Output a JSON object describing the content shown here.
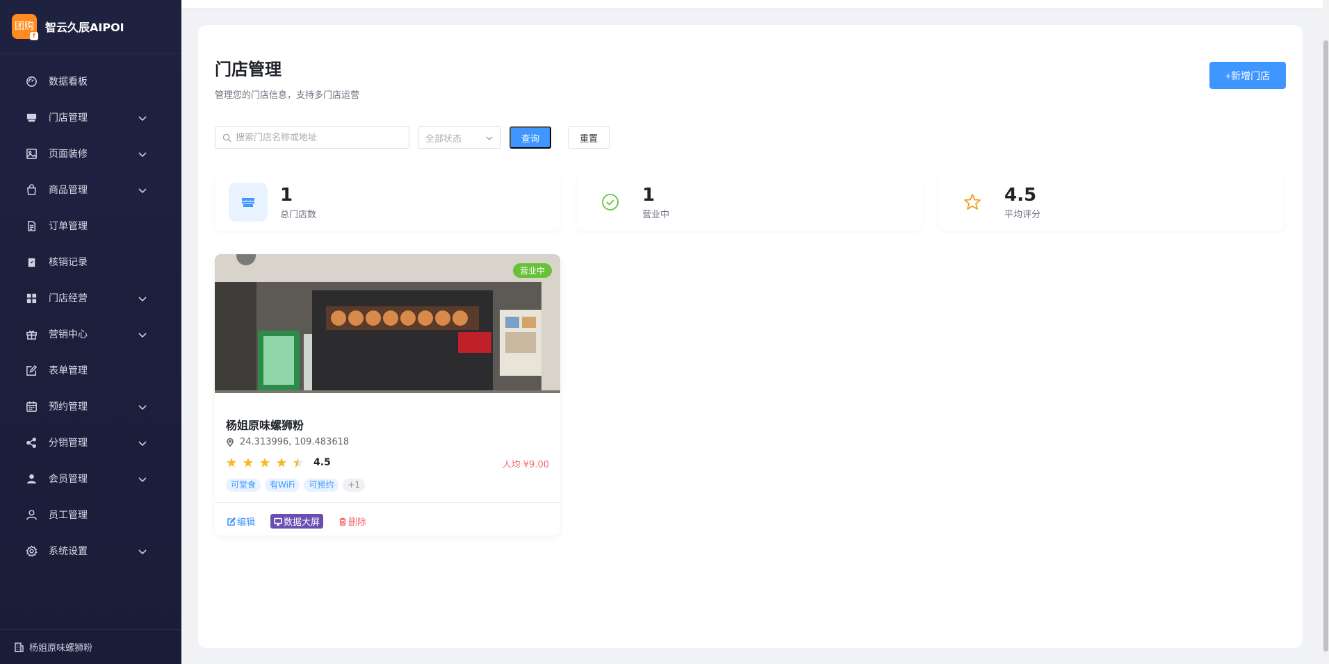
{
  "brand": {
    "logo_text": "团购",
    "logo_sub": "f",
    "name": "智云久辰AIPOI"
  },
  "sidebar": {
    "items": [
      {
        "label": "数据看板",
        "icon": "dashboard-icon",
        "expandable": false
      },
      {
        "label": "门店管理",
        "icon": "store-icon",
        "expandable": true
      },
      {
        "label": "页面装修",
        "icon": "image-icon",
        "expandable": true
      },
      {
        "label": "商品管理",
        "icon": "shopping-bag-icon",
        "expandable": true
      },
      {
        "label": "订单管理",
        "icon": "document-icon",
        "expandable": false
      },
      {
        "label": "核销记录",
        "icon": "clipboard-check-icon",
        "expandable": false
      },
      {
        "label": "门店经营",
        "icon": "grid-icon",
        "expandable": true
      },
      {
        "label": "营销中心",
        "icon": "gift-icon",
        "expandable": true
      },
      {
        "label": "表单管理",
        "icon": "edit-icon",
        "expandable": false
      },
      {
        "label": "预约管理",
        "icon": "calendar-icon",
        "expandable": true
      },
      {
        "label": "分销管理",
        "icon": "share-icon",
        "expandable": true
      },
      {
        "label": "会员管理",
        "icon": "user-filled-icon",
        "expandable": true
      },
      {
        "label": "员工管理",
        "icon": "user-icon",
        "expandable": false
      },
      {
        "label": "系统设置",
        "icon": "gear-icon",
        "expandable": true
      }
    ],
    "footer": "杨姐原味螺狮粉"
  },
  "page": {
    "title": "门店管理",
    "subtitle": "管理您的门店信息，支持多门店运营",
    "add_button": "+新增门店"
  },
  "filters": {
    "search_placeholder": "搜索门店名称或地址",
    "status_placeholder": "全部状态",
    "query_button": "查询",
    "reset_button": "重置"
  },
  "stats": [
    {
      "value": "1",
      "label": "总门店数"
    },
    {
      "value": "1",
      "label": "营业中"
    },
    {
      "value": "4.5",
      "label": "平均评分"
    }
  ],
  "store": {
    "status": "营业中",
    "name": "杨姐原味螺狮粉",
    "location": "24.313996, 109.483618",
    "rating": "4.5",
    "rating_fraction": 0.9,
    "avg_price": "人均 ¥9.00",
    "tags": [
      "可堂食",
      "有WiFi",
      "可预约",
      "+1"
    ],
    "actions": {
      "edit": "编辑",
      "screen": "数据大屏",
      "delete": "删除"
    }
  },
  "colors": {
    "sidebar_bg": "#1e2140",
    "primary": "#4096ff",
    "success": "#67c23a",
    "danger": "#f56c6c",
    "star": "#f7ba2a",
    "screen_button": "#6a4fb0"
  }
}
